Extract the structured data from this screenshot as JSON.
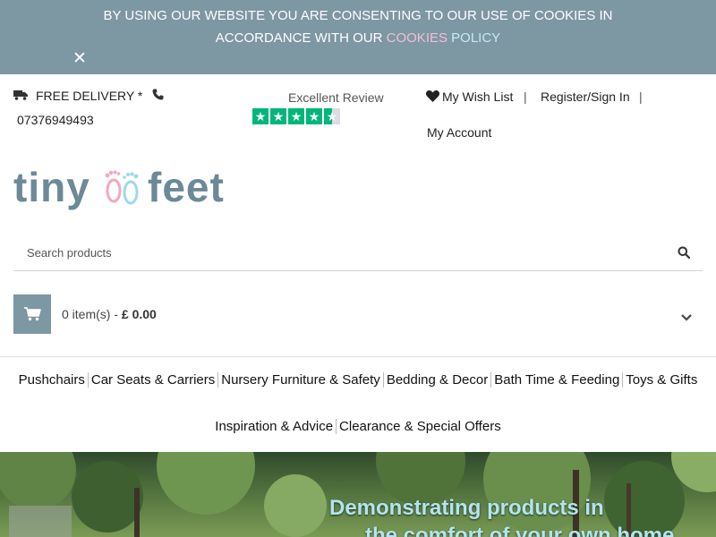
{
  "cookie_banner": {
    "text_line1": "BY USING OUR WEBSITE YOU ARE CONSENTING TO OUR USE OF COOKIES IN",
    "text_line2_prefix": "ACCORDANCE WITH OUR",
    "link_part1": "COOKIES",
    "link_part2": "POLICY",
    "close_icon": "close-icon"
  },
  "topbar": {
    "delivery_label": "FREE DELIVERY *",
    "phone": "07376949493",
    "review_label": "Excellent Review",
    "rating_stars": 4.5,
    "wishlist_label": "My Wish List",
    "separator": "|",
    "register_label": "Register/Sign In",
    "account_label": "My Account"
  },
  "logo": {
    "word1": "tiny",
    "word2": "feet",
    "colors": {
      "text": "#6c8997",
      "foot_pink": "#f2a6c4",
      "foot_blue": "#9fd8eb"
    }
  },
  "search": {
    "placeholder": "Search products"
  },
  "cart": {
    "summary": "0 item(s) -",
    "total": "£ 0.00"
  },
  "nav": {
    "row1": [
      "Pushchairs",
      "Car Seats & Carriers",
      "Nursery Furniture & Safety",
      "Bedding & Decor",
      "Bath Time & Feeding",
      "Toys & Gifts"
    ],
    "row2": [
      "Inspiration & Advice",
      "Clearance & Special Offers"
    ]
  },
  "hero": {
    "headline_line1": "Demonstrating products in",
    "headline_line2": "the comfort of your own home"
  },
  "colors": {
    "accent": "#7d97a3",
    "trustpilot_green": "#00b67a",
    "cookie_pink": "#f2bfd6",
    "cookie_blue": "#c2ecf7"
  }
}
